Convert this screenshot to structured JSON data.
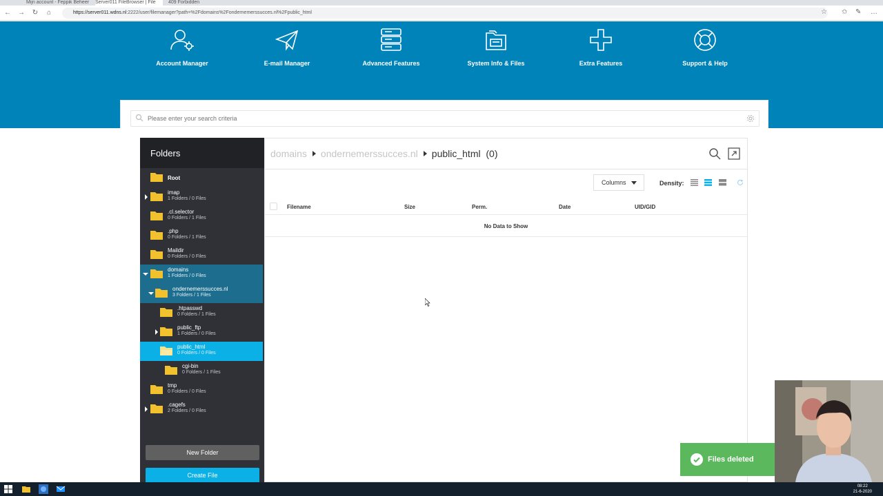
{
  "browser": {
    "tabs": [
      "Mijn account - Feppik Beheer",
      "Server011 FileBrowser | File",
      "409 Forbidden"
    ],
    "url_host": "https://server011.wdns.nl",
    "url_path": ":2222/user/filemanager?path=%2Fdomains%2Fondernemerssucces.nl%2Fpublic_html"
  },
  "topnav": [
    {
      "label": "Account Manager",
      "icon": "account-manager-icon"
    },
    {
      "label": "E-mail Manager",
      "icon": "paper-plane-icon"
    },
    {
      "label": "Advanced Features",
      "icon": "server-stack-icon"
    },
    {
      "label": "System Info & Files",
      "icon": "folder-files-icon"
    },
    {
      "label": "Extra Features",
      "icon": "plus-icon"
    },
    {
      "label": "Support & Help",
      "icon": "lifebuoy-icon"
    }
  ],
  "search": {
    "placeholder": "Please enter your search criteria"
  },
  "folders": {
    "title": "Folders",
    "items": [
      {
        "name": "Root",
        "count": ""
      },
      {
        "name": "imap",
        "count": "1 Folders / 0 Files"
      },
      {
        "name": ".cl.selector",
        "count": "0 Folders / 1 Files"
      },
      {
        "name": ".php",
        "count": "0 Folders / 1 Files"
      },
      {
        "name": "Maildir",
        "count": "0 Folders / 0 Files"
      },
      {
        "name": "domains",
        "count": "1 Folders / 0 Files"
      },
      {
        "name": "ondernemerssucces.nl",
        "count": "3 Folders / 1 Files"
      },
      {
        "name": ".htpasswd",
        "count": "0 Folders / 1 Files"
      },
      {
        "name": "public_ftp",
        "count": "1 Folders / 0 Files"
      },
      {
        "name": "public_html",
        "count": "0 Folders / 0 Files"
      },
      {
        "name": "cgi-bin",
        "count": "0 Folders / 1 Files"
      },
      {
        "name": "tmp",
        "count": "0 Folders / 0 Files"
      },
      {
        "name": ".cagefs",
        "count": "2 Folders / 0 Files"
      }
    ],
    "new_folder_label": "New Folder",
    "create_file_label": "Create File"
  },
  "main": {
    "breadcrumb": [
      "domains",
      "ondernemerssucces.nl"
    ],
    "current": "public_html",
    "count": "(0)",
    "columns_label": "Columns",
    "density_label": "Density:",
    "headers": [
      "Filename",
      "Size",
      "Perm.",
      "Date",
      "UID/GID"
    ],
    "empty": "No Data to Show"
  },
  "toast": {
    "text": "Files deleted"
  },
  "taskbar": {
    "time": "08:22",
    "date": "21-6-2020"
  },
  "colors": {
    "brand_blue": "#0083b9",
    "accent": "#0ab0e6",
    "panel_dark": "#2f3136",
    "success": "#5cb85c",
    "folder": "#f2c12e"
  }
}
